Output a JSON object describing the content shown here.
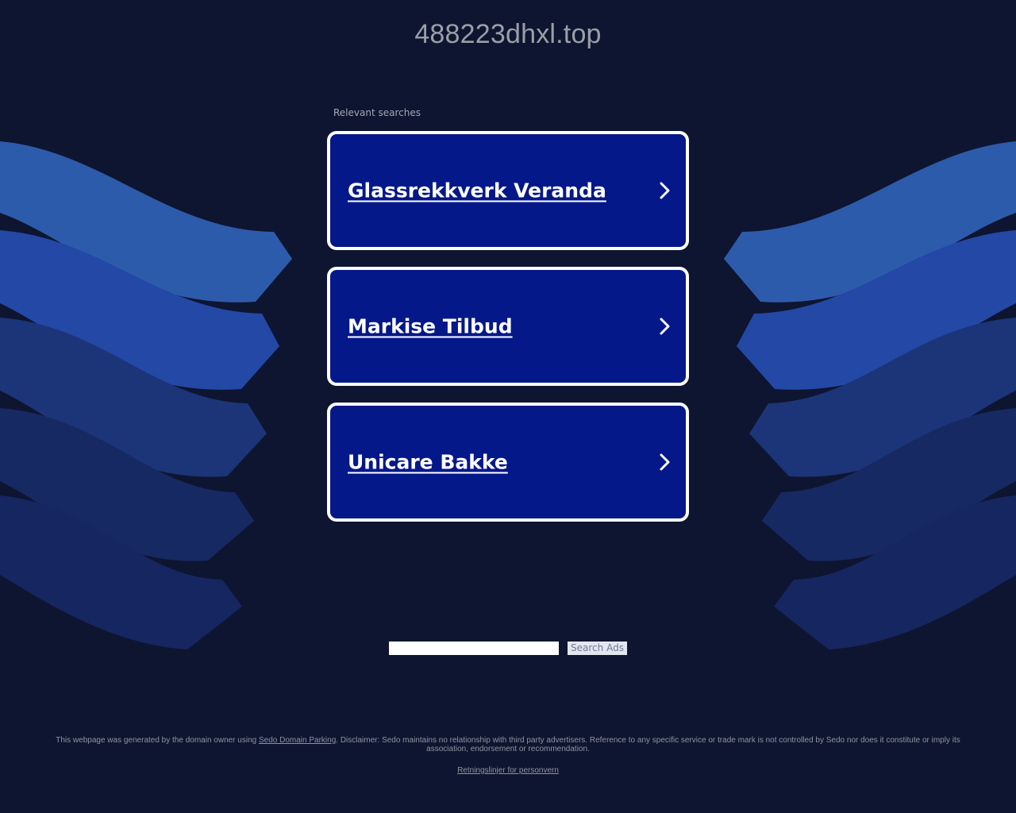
{
  "header": {
    "domain": "488223dhxl.top"
  },
  "searches": {
    "label": "Relevant searches",
    "items": [
      {
        "label": "Glassrekkverk Veranda"
      },
      {
        "label": "Markise Tilbud"
      },
      {
        "label": "Unicare Bakke"
      }
    ]
  },
  "search": {
    "value": "",
    "placeholder": "",
    "button_label": "Search Ads"
  },
  "footer": {
    "prefix": "This webpage was generated by the domain owner using ",
    "link_label": "Sedo Domain Parking",
    "disclaimer": ". Disclaimer: Sedo maintains no relationship with third party advertisers. Reference to any specific service or trade mark is not controlled by Sedo nor does it constitute or imply its association, endorsement or recommendation.",
    "privacy_label": "Retningslinjer for personvern"
  },
  "colors": {
    "background": "#0e1530",
    "card_fill": "#05188a",
    "card_border": "#ffffff",
    "wave_light": "#2c5aa8",
    "wave_mid": "#2449a5",
    "wave_dark": "#1a3275"
  },
  "icons": {
    "card_chevron": "chevron-right-icon"
  }
}
